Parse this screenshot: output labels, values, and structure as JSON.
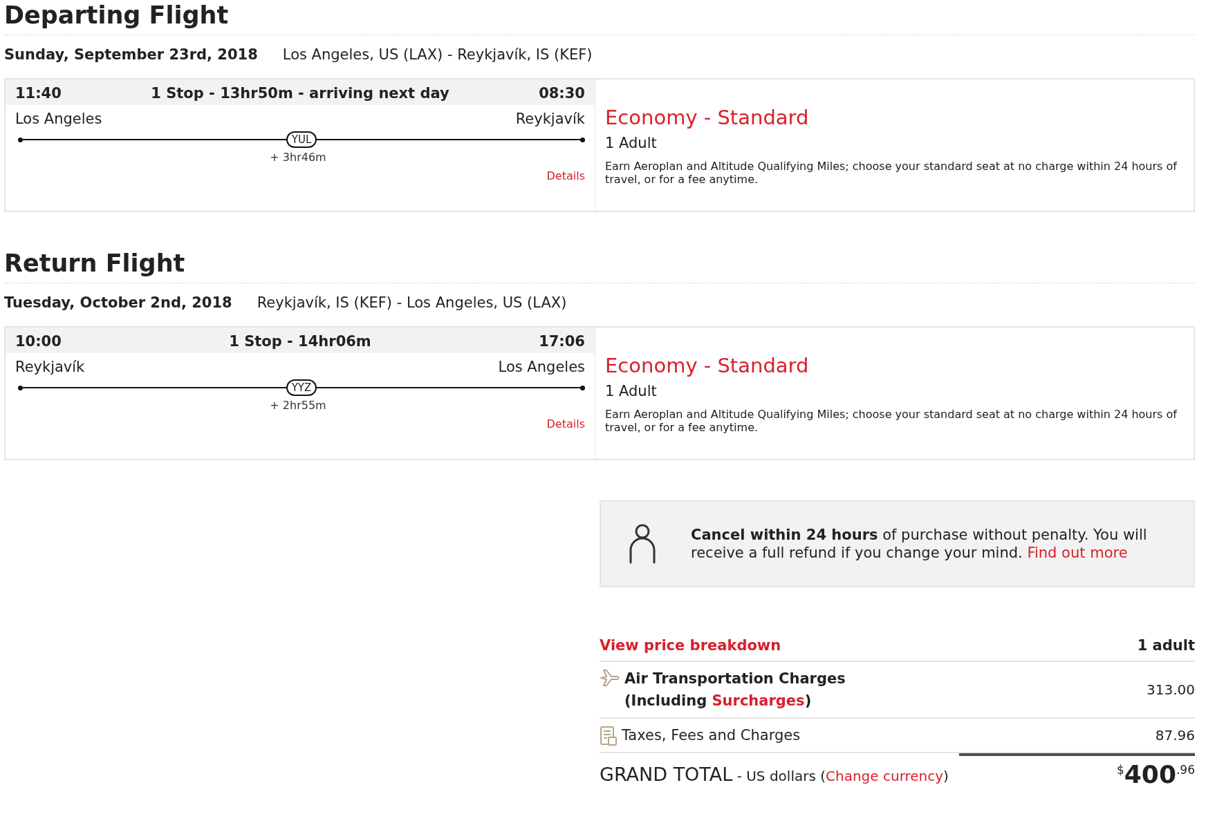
{
  "flights": [
    {
      "title": "Departing Flight",
      "date": "Sunday, September 23rd, 2018",
      "route": "Los Angeles, US (LAX) - Reykjavík, IS (KEF)",
      "depart_time": "11:40",
      "summary": "1 Stop - 13hr50m - arriving next day",
      "arrive_time": "08:30",
      "origin": "Los Angeles",
      "destination": "Reykjavík",
      "stop_code": "YUL",
      "layover": "+ 3hr46m",
      "details_link": "Details",
      "fare_name": "Economy - Standard",
      "passengers": "1 Adult",
      "fare_description": "Earn Aeroplan and Altitude Qualifying Miles; choose your standard seat at no charge within 24 hours of travel, or for a fee anytime."
    },
    {
      "title": "Return Flight",
      "date": "Tuesday, October 2nd, 2018",
      "route": "Reykjavík, IS (KEF) - Los Angeles, US (LAX)",
      "depart_time": "10:00",
      "summary": "1 Stop - 14hr06m",
      "arrive_time": "17:06",
      "origin": "Reykjavík",
      "destination": "Los Angeles",
      "stop_code": "YYZ",
      "layover": "+ 2hr55m",
      "details_link": "Details",
      "fare_name": "Economy - Standard",
      "passengers": "1 Adult",
      "fare_description": "Earn Aeroplan and Altitude Qualifying Miles; choose your standard seat at no charge within 24 hours of travel, or for a fee anytime."
    }
  ],
  "cancel_notice": {
    "text": "**Cancel within 24 hours** of purchase without penalty. You will receive a full refund if you change your mind.",
    "link": "Find out more"
  },
  "price": {
    "breakdown_link": "View price breakdown",
    "passengers": "1 adult",
    "rows": [
      {
        "kind": "air",
        "label": "Air Transportation Charges (Including ",
        "link": "Surcharges",
        "label_end": ")",
        "amount": "313.00"
      },
      {
        "kind": "taxes",
        "label": "Taxes, Fees and Charges",
        "amount": "87.96"
      }
    ],
    "total": {
      "label": "GRAND TOTAL",
      "currency_note": "- US dollars (",
      "currency_link": "Change currency",
      "currency_note_end": ")",
      "symbol": "$",
      "whole": "400",
      "cents": ".96"
    }
  }
}
